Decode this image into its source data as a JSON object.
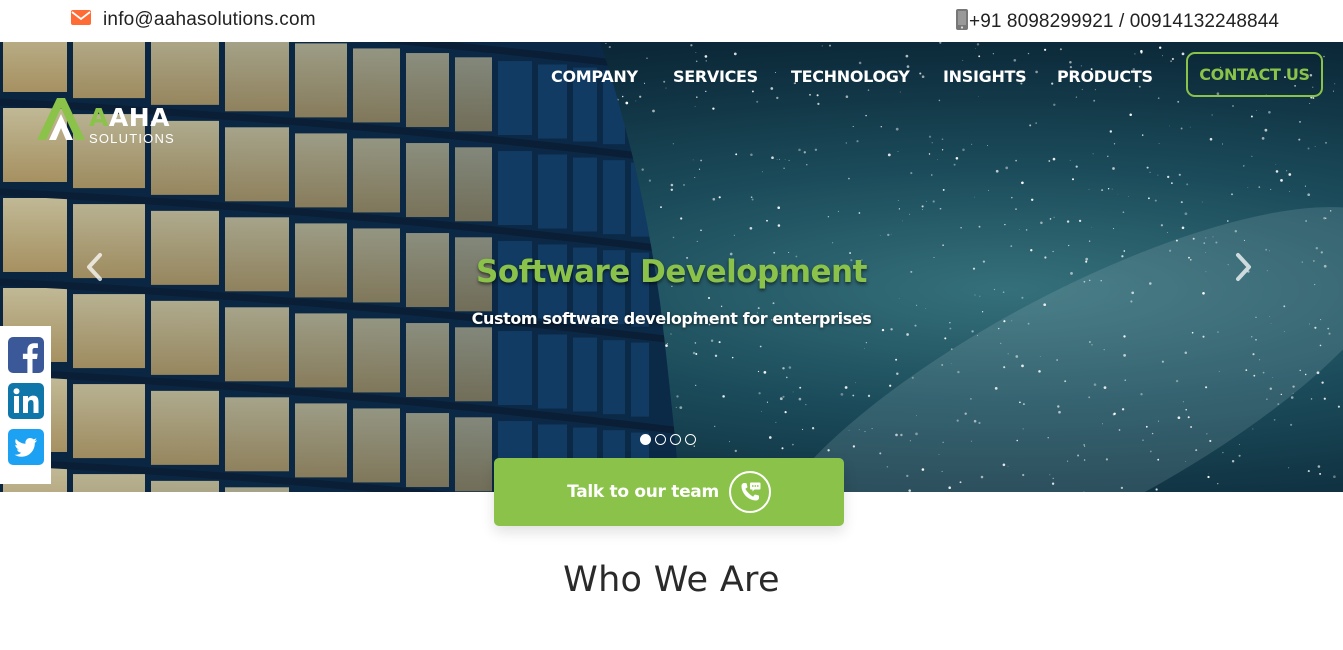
{
  "topbar": {
    "email": "info@aahasolutions.com",
    "phone": "+91 8098299921 / 00914132248844",
    "email_icon": "envelope-icon",
    "phone_icon": "mobile-phone-icon",
    "accent_color": "#ff6b35"
  },
  "logo": {
    "name_part1": "A",
    "name_part2": "AHA",
    "subtitle": "SOLUTIONS"
  },
  "nav": {
    "items": [
      "COMPANY",
      "SERVICES",
      "TECHNOLOGY",
      "INSIGHTS",
      "PRODUCTS"
    ],
    "cta": "CONTACT US"
  },
  "hero": {
    "title": "Software Development",
    "subtitle": "Custom software development for enterprises",
    "slide_count": 4,
    "active_slide": 1,
    "prev_icon": "chevron-left-icon",
    "next_icon": "chevron-right-icon"
  },
  "social": {
    "items": [
      "facebook-icon",
      "linkedin-icon",
      "twitter-icon"
    ]
  },
  "cta": {
    "label": "Talk to our team",
    "icon": "phone-chat-icon"
  },
  "section": {
    "title": "Who We Are"
  },
  "colors": {
    "brand_green": "#8bc34a",
    "facebook": "#3b5998",
    "linkedin": "#0077b5",
    "twitter": "#1da1f2"
  }
}
